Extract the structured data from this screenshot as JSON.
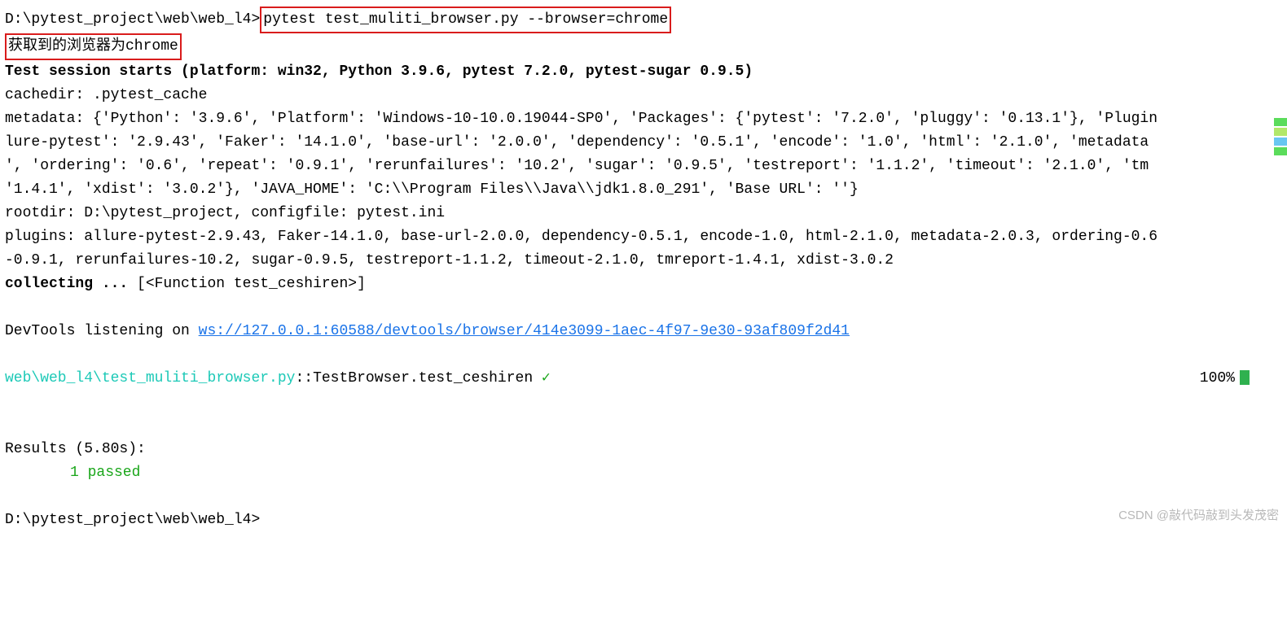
{
  "prompt1": {
    "path": "D:\\pytest_project\\web\\web_l4>",
    "command": "pytest test_muliti_browser.py --browser=chrome"
  },
  "msg_cn": "获取到的浏览器为chrome",
  "session_header": "Test session starts (platform: win32, Python 3.9.6, pytest 7.2.0, pytest-sugar 0.9.5)",
  "cachedir": "cachedir: .pytest_cache",
  "metadata": {
    "l1": "metadata: {'Python': '3.9.6', 'Platform': 'Windows-10-10.0.19044-SP0', 'Packages': {'pytest': '7.2.0', 'pluggy': '0.13.1'}, 'Plugin",
    "l2": "lure-pytest': '2.9.43', 'Faker': '14.1.0', 'base-url': '2.0.0', 'dependency': '0.5.1', 'encode': '1.0', 'html': '2.1.0', 'metadata",
    "l3": "', 'ordering': '0.6', 'repeat': '0.9.1', 'rerunfailures': '10.2', 'sugar': '0.9.5', 'testreport': '1.1.2', 'timeout': '2.1.0', 'tm",
    "l4": "'1.4.1', 'xdist': '3.0.2'}, 'JAVA_HOME': 'C:\\\\Program Files\\\\Java\\\\jdk1.8.0_291', 'Base URL': ''}"
  },
  "rootdir": "rootdir: D:\\pytest_project, configfile: pytest.ini",
  "plugins": {
    "l1": "plugins: allure-pytest-2.9.43, Faker-14.1.0, base-url-2.0.0, dependency-0.5.1, encode-1.0, html-2.1.0, metadata-2.0.3, ordering-0.6",
    "l2": "-0.9.1, rerunfailures-10.2, sugar-0.9.5, testreport-1.1.2, timeout-2.1.0, tmreport-1.4.1, xdist-3.0.2"
  },
  "collecting": {
    "prefix": "collecting ... ",
    "items": "[<Function test_ceshiren>]"
  },
  "devtools": {
    "prefix": "DevTools listening on ",
    "url": "ws://127.0.0.1:60588/devtools/browser/414e3099-1aec-4f97-9e30-93af809f2d41"
  },
  "testline": {
    "path": " web\\web_l4\\test_muliti_browser.py",
    "sep": "::",
    "name": "TestBrowser.test_ceshiren",
    "mark": " ✓",
    "percent": "100%"
  },
  "results": {
    "header": "Results (5.80s):",
    "passed": "1 passed"
  },
  "prompt2": "D:\\pytest_project\\web\\web_l4>",
  "watermark": "CSDN @敲代码敲到头发茂密"
}
